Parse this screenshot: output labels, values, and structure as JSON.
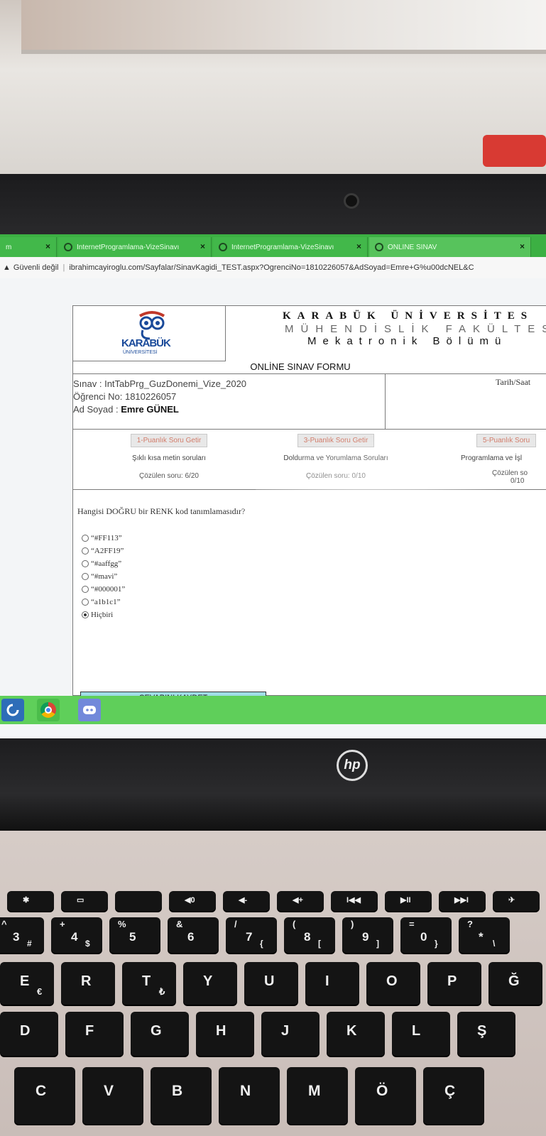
{
  "browser": {
    "tabs": [
      {
        "label": "m"
      },
      {
        "label": "InternetProgramlama-VizeSinavı"
      },
      {
        "label": "InternetProgramlama-VizeSinavı"
      },
      {
        "label": "ONLINE SINAV"
      }
    ],
    "security_label": "Güvenli değil",
    "url": "ibrahimcayiroglu.com/Sayfalar/SinavKagidi_TEST.aspx?OgrenciNo=1810226057&AdSoyad=Emre+G%u00dcNEL&C"
  },
  "header": {
    "logo_text": "KARABÜK",
    "logo_sub": "ÜNİVERSİTESİ",
    "university": "KARABÜK ÜNİVERSİTES",
    "faculty": "MÜHENDİSLİK FAKÜLTES",
    "department": "Mekatronik Bölümü",
    "form_title": "ONLİNE SINAV FORMU"
  },
  "info": {
    "exam_line": "Sınav : IntTabPrg_GuzDonemi_Vize_2020",
    "student_no_line": "Öğrenci No: 1810226057",
    "name_label": "Ad Soyad : ",
    "name_value": "Emre GÜNEL",
    "date_label": "Tarih/Saat"
  },
  "question_groups": [
    {
      "button": "1-Puanlık Soru Getir",
      "desc": "Şıklı kısa metin soruları",
      "count": "Çözülen soru: 6/20"
    },
    {
      "button": "3-Puanlık Soru Getir",
      "desc": "Doldurma ve Yorumlama Soruları",
      "count": "Çözülen soru: 0/10"
    },
    {
      "button": "5-Puanlık Soru",
      "desc": "Programlama ve İşl",
      "count": "Çözülen so",
      "count2": "0/10"
    }
  ],
  "question": {
    "text": "Hangisi DOĞRU bir RENK kod tanımlamasıdır?",
    "options": [
      "“#FF113”",
      "“A2FF19”",
      "“#aaffgg”",
      "“#mavi”",
      "“#000001”",
      "“a1b1c1”",
      "Hiçbiri"
    ],
    "selected_index": 6
  },
  "save_button": "CEVABINI KAYDET",
  "hp_logo": "hp",
  "keyboard": {
    "fn_row": [
      "✱",
      "▭",
      "",
      "◀0",
      "◀-",
      "◀+",
      "I◀◀",
      "▶II",
      "▶▶I",
      "✈"
    ],
    "num_row": [
      {
        "main": "3",
        "shift": "^",
        "alt": "#"
      },
      {
        "main": "4",
        "shift": "+",
        "alt": "$"
      },
      {
        "main": "5",
        "shift": "%",
        "alt": ""
      },
      {
        "main": "6",
        "shift": "&",
        "alt": ""
      },
      {
        "main": "7",
        "shift": "/",
        "alt": "{"
      },
      {
        "main": "8",
        "shift": "(",
        "alt": "["
      },
      {
        "main": "9",
        "shift": ")",
        "alt": "]"
      },
      {
        "main": "0",
        "shift": "=",
        "alt": "}"
      },
      {
        "main": "*",
        "shift": "?",
        "alt": "\\"
      }
    ],
    "row_q": [
      {
        "main": "E",
        "alt": "€"
      },
      {
        "main": "R",
        "alt": ""
      },
      {
        "main": "T",
        "alt": "₺"
      },
      {
        "main": "Y",
        "alt": ""
      },
      {
        "main": "U",
        "alt": ""
      },
      {
        "main": "I",
        "alt": ""
      },
      {
        "main": "O",
        "alt": ""
      },
      {
        "main": "P",
        "alt": ""
      },
      {
        "main": "Ğ",
        "alt": ""
      }
    ],
    "row_a": [
      "D",
      "F",
      "G",
      "H",
      "J",
      "K",
      "L",
      "Ş"
    ],
    "row_z": [
      "C",
      "V",
      "B",
      "N",
      "M",
      "Ö",
      "Ç"
    ]
  }
}
